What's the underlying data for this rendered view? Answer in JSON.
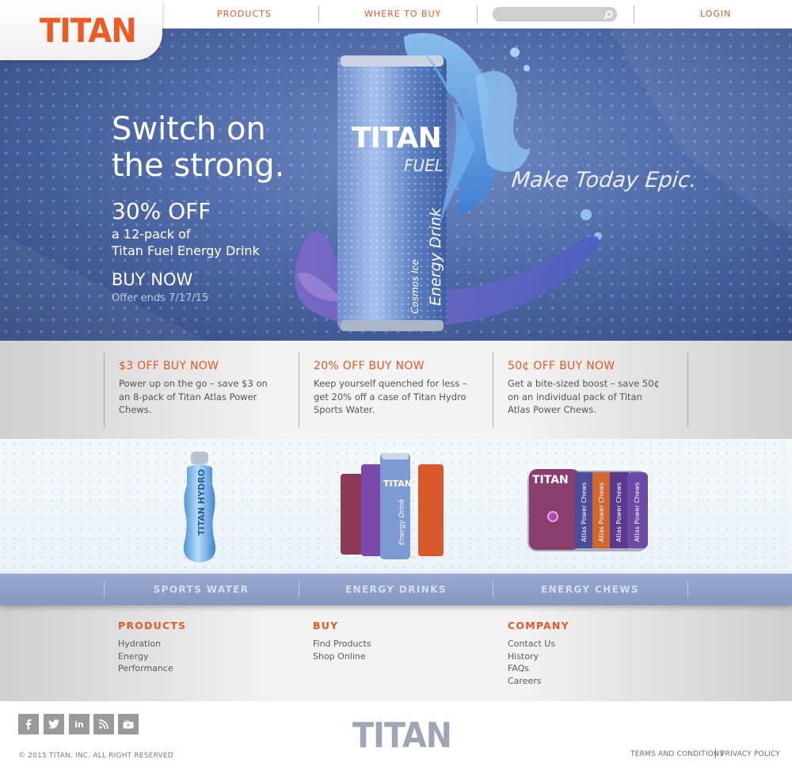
{
  "header": {
    "logo": "TITAN",
    "nav": {
      "products": "PRODUCTS",
      "where_to_buy": "WHERE TO BUY",
      "login": "LOGIN"
    },
    "search": {
      "placeholder": "",
      "value": ""
    }
  },
  "hero": {
    "headline_line1": "Switch on",
    "headline_line2": "the strong.",
    "offer": "30% OFF",
    "offer_desc_line1": "a 12-pack of",
    "offer_desc_line2": "Titan Fuel Energy Drink",
    "cta": "BUY NOW",
    "offer_ends": "Offer ends 7/17/15",
    "tagline": "Make Today Epic.",
    "can_brand": "TITAN",
    "can_sub": "FUEL",
    "can_flavor": "Cosmos Ice",
    "can_type": "Energy Drink"
  },
  "promos": [
    {
      "title": "$3 OFF BUY NOW",
      "desc": "Power up on the go – save $3 on an 8-pack of Titan Atlas Power Chews."
    },
    {
      "title": "20% OFF BUY NOW",
      "desc": "Keep yourself quenched for less – get 20% off a case of Titan Hydro Sports Water."
    },
    {
      "title": "50¢ OFF BUY NOW",
      "desc": "Get a bite-sized boost – save 50¢ on an individual pack of Titan Atlas Power Chews."
    }
  ],
  "products": {
    "bottle_text": "TITAN HYDRO",
    "chews_text": "Atlas Power Chews"
  },
  "categories": [
    "SPORTS WATER",
    "ENERGY DRINKS",
    "ENERGY CHEWS"
  ],
  "footer": {
    "columns": [
      {
        "heading": "PRODUCTS",
        "links": [
          "Hydration",
          "Energy",
          "Performance"
        ]
      },
      {
        "heading": "BUY",
        "links": [
          "Find Products",
          "Shop Online"
        ]
      },
      {
        "heading": "COMPANY",
        "links": [
          "Contact Us",
          "History",
          "FAQs",
          "Careers"
        ]
      }
    ],
    "social": [
      "f",
      "twitter",
      "in",
      "rss",
      "youtube"
    ],
    "copyright": "© 2015 TITAN, INC. ALL RIGHT RESERVED",
    "logo": "TITAN",
    "terms": "TERMS AND CONDITIONS",
    "privacy": "PRIVACY POLICY"
  },
  "colors": {
    "accent": "#e15a27",
    "hero_blue": "#4f6aa8",
    "category_bar": "#8f9fc8"
  }
}
